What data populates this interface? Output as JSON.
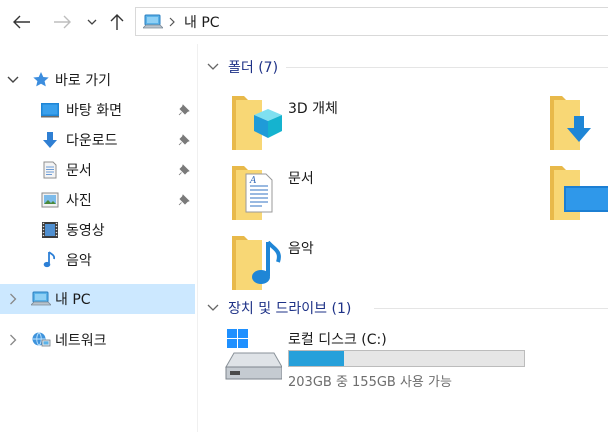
{
  "address_bar": {
    "path": "내 PC",
    "pc_icon": "computer-icon",
    "back_icon": "arrow-left-icon",
    "forward_icon": "arrow-right-icon",
    "recent_icon": "chevron-down-icon",
    "up_icon": "arrow-up-icon"
  },
  "sidebar": {
    "quick_access": {
      "label": "바로 가기",
      "icon": "star-icon",
      "items": [
        {
          "label": "바탕 화면",
          "icon": "desktop-icon",
          "pinned": true
        },
        {
          "label": "다운로드",
          "icon": "download-icon",
          "pinned": true
        },
        {
          "label": "문서",
          "icon": "document-icon",
          "pinned": true
        },
        {
          "label": "사진",
          "icon": "picture-icon",
          "pinned": true
        },
        {
          "label": "동영상",
          "icon": "video-icon",
          "pinned": false
        },
        {
          "label": "음악",
          "icon": "music-icon",
          "pinned": false
        }
      ]
    },
    "this_pc": {
      "label": "내 PC",
      "icon": "computer-icon",
      "selected": true
    },
    "network": {
      "label": "네트워크",
      "icon": "network-icon"
    }
  },
  "content": {
    "folders_group": {
      "title": "폴더 (7)",
      "items": [
        {
          "label": "3D 개체",
          "icon": "3d-objects-folder-icon"
        },
        {
          "label": "",
          "icon": "downloads-folder-icon"
        },
        {
          "label": "문서",
          "icon": "documents-folder-icon"
        },
        {
          "label": "",
          "icon": "desktop-folder-icon"
        },
        {
          "label": "음악",
          "icon": "music-folder-icon"
        }
      ]
    },
    "drives_group": {
      "title": "장치 및 드라이브 (1)",
      "drives": [
        {
          "label": "로컬 디스크 (C:)",
          "space_text": "203GB 중 155GB 사용 가능",
          "used_fraction": 0.236,
          "icon": "windows-drive-icon"
        }
      ]
    }
  },
  "colors": {
    "accent": "#26a0da",
    "selection": "#cce8ff",
    "group_title": "#1e3287",
    "folder_yellow": "#f8d775"
  }
}
